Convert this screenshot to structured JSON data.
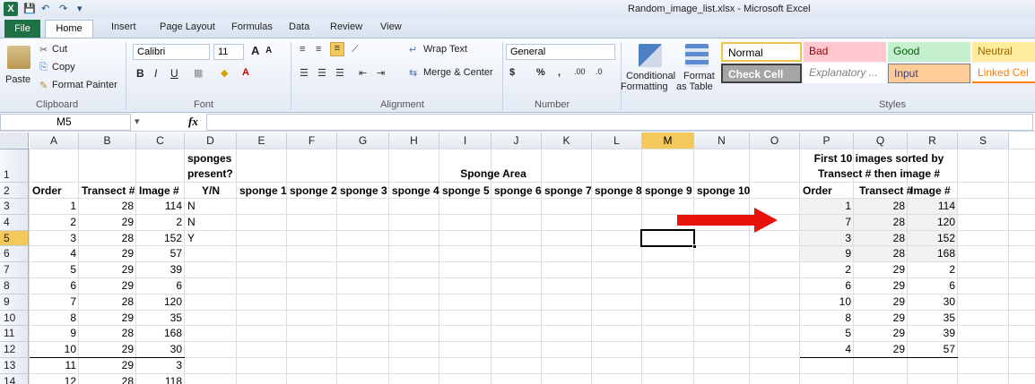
{
  "window": {
    "title": "Random_image_list.xlsx - Microsoft Excel"
  },
  "quick_access": {
    "logo": "X",
    "save_icon": "save-icon",
    "undo_icon": "undo-icon",
    "redo_icon": "redo-icon"
  },
  "tabs": [
    "File",
    "Home",
    "Insert",
    "Page Layout",
    "Formulas",
    "Data",
    "Review",
    "View"
  ],
  "ribbon": {
    "clipboard": {
      "paste": "Paste",
      "cut": "Cut",
      "copy": "Copy",
      "format_painter": "Format Painter",
      "label": "Clipboard"
    },
    "font": {
      "name": "Calibri",
      "size": "11",
      "label": "Font",
      "bold": "B",
      "italic": "I",
      "underline": "U",
      "grow": "A",
      "shrink": "A"
    },
    "alignment": {
      "wrap": "Wrap Text",
      "merge": "Merge & Center",
      "label": "Alignment"
    },
    "number": {
      "format": "General",
      "currency": "$",
      "percent": "%",
      "comma": ",",
      "inc_dec": ".00",
      "dec_dec": ".0",
      "label": "Number"
    },
    "styles": {
      "conditional_1": "Conditional",
      "conditional_2": "Formatting",
      "format_table_1": "Format",
      "format_table_2": "as Table",
      "label": "Styles",
      "cells": [
        {
          "label": "Normal"
        },
        {
          "label": "Bad"
        },
        {
          "label": "Good"
        },
        {
          "label": "Neutral"
        },
        {
          "label": "Check Cell"
        },
        {
          "label": "Explanatory ..."
        },
        {
          "label": "Input"
        },
        {
          "label": "Linked Cel"
        }
      ]
    }
  },
  "formula_bar": {
    "name_box": "M5",
    "fx": "fx",
    "value": ""
  },
  "columns": [
    "A",
    "B",
    "C",
    "D",
    "E",
    "F",
    "G",
    "H",
    "I",
    "J",
    "K",
    "L",
    "M",
    "N",
    "O",
    "P",
    "Q",
    "R",
    "S"
  ],
  "rows": [
    "1",
    "2",
    "3",
    "4",
    "5",
    "6",
    "7",
    "8",
    "9",
    "10",
    "11",
    "12",
    "13",
    "14"
  ],
  "sheet": {
    "d1_line1": "sponges",
    "d1_line2": "present?",
    "sponge_area_title": "Sponge Area",
    "p1_line1": "First 10 images sorted by",
    "p1_line2": "Transect # then image #",
    "headers": {
      "order": "Order",
      "transect": "Transect #",
      "image": "Image #",
      "yn": "Y/N",
      "sponges": [
        "sponge 1",
        "sponge 2",
        "sponge 3",
        "sponge 4",
        "sponge 5",
        "sponge 6",
        "sponge 7",
        "sponge 8",
        "sponge 9",
        "sponge 10"
      ],
      "p_order": "Order",
      "p_transect": "Transect #",
      "p_image": "Image #"
    },
    "data_rows": [
      {
        "order": "1",
        "transect": "28",
        "image": "114",
        "present": "N"
      },
      {
        "order": "2",
        "transect": "29",
        "image": "2",
        "present": "N"
      },
      {
        "order": "3",
        "transect": "28",
        "image": "152",
        "present": "Y"
      },
      {
        "order": "4",
        "transect": "29",
        "image": "57",
        "present": ""
      },
      {
        "order": "5",
        "transect": "29",
        "image": "39",
        "present": ""
      },
      {
        "order": "6",
        "transect": "29",
        "image": "6",
        "present": ""
      },
      {
        "order": "7",
        "transect": "28",
        "image": "120",
        "present": ""
      },
      {
        "order": "8",
        "transect": "29",
        "image": "35",
        "present": ""
      },
      {
        "order": "9",
        "transect": "28",
        "image": "168",
        "present": ""
      },
      {
        "order": "10",
        "transect": "29",
        "image": "30",
        "present": ""
      },
      {
        "order": "11",
        "transect": "29",
        "image": "3",
        "present": ""
      },
      {
        "order": "12",
        "transect": "28",
        "image": "118",
        "present": ""
      }
    ],
    "sorted_rows": [
      {
        "order": "1",
        "transect": "28",
        "image": "114"
      },
      {
        "order": "7",
        "transect": "28",
        "image": "120"
      },
      {
        "order": "3",
        "transect": "28",
        "image": "152"
      },
      {
        "order": "9",
        "transect": "28",
        "image": "168"
      },
      {
        "order": "2",
        "transect": "29",
        "image": "2"
      },
      {
        "order": "6",
        "transect": "29",
        "image": "6"
      },
      {
        "order": "10",
        "transect": "29",
        "image": "30"
      },
      {
        "order": "8",
        "transect": "29",
        "image": "35"
      },
      {
        "order": "5",
        "transect": "29",
        "image": "39"
      },
      {
        "order": "4",
        "transect": "29",
        "image": "57"
      }
    ]
  },
  "colors": {
    "accent_green": "#1e7145",
    "selected_header": "#f5c85b",
    "arrow": "#e8120c",
    "shaded_range": "#f1f1f1"
  }
}
